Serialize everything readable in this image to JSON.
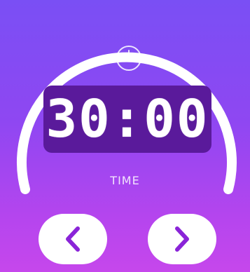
{
  "timer": {
    "display": "30:00",
    "label": "TIME"
  },
  "icons": {
    "clock": "clock-icon",
    "prev": "chevron-left-icon",
    "next": "chevron-right-icon"
  },
  "colors": {
    "background_top": "#7a4ff4",
    "background_bottom": "#c647ec",
    "display_bg": "#5a1a9b",
    "accent_chevron": "#8a24d8",
    "text": "#ffffff"
  }
}
